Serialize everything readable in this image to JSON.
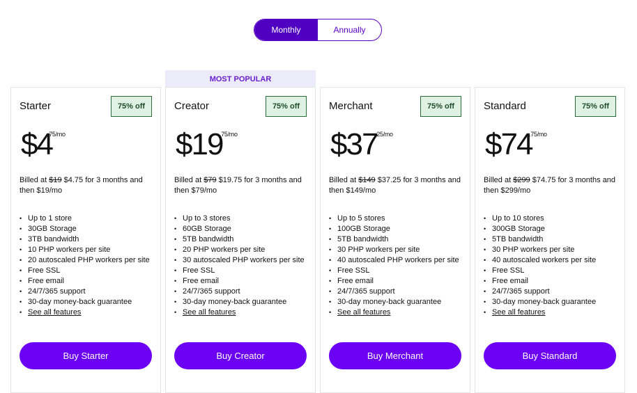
{
  "toggle": {
    "monthly": "Monthly",
    "annually": "Annually"
  },
  "popular_label": "MOST POPULAR",
  "plans": [
    {
      "name": "Starter",
      "badge": "75% off",
      "price": "$4",
      "cents": ".75/mo",
      "billed_prefix": "Billed at ",
      "old": "$19",
      "billed_rest": " $4.75 for 3 months and then $19/mo",
      "features": [
        "Up to 1 store",
        "30GB Storage",
        "3TB bandwidth",
        "10 PHP workers per site",
        "20 autoscaled PHP workers per site",
        "Free SSL",
        "Free email",
        "24/7/365 support",
        "30-day money-back guarantee"
      ],
      "link": "See all features",
      "button": "Buy Starter"
    },
    {
      "name": "Creator",
      "badge": "75% off",
      "price": "$19",
      "cents": ".75/mo",
      "billed_prefix": "Billed at ",
      "old": "$79",
      "billed_rest": " $19.75 for 3 months and then $79/mo",
      "features": [
        "Up to 3 stores",
        "60GB Storage",
        "5TB bandwidth",
        "20 PHP workers per site",
        "30 autoscaled PHP workers per site",
        "Free SSL",
        "Free email",
        "24/7/365 support",
        "30-day money-back guarantee"
      ],
      "link": "See all features",
      "button": "Buy Creator"
    },
    {
      "name": "Merchant",
      "badge": "75% off",
      "price": "$37",
      "cents": ".25/mo",
      "billed_prefix": "Billed at ",
      "old": "$149",
      "billed_rest": " $37.25 for 3 months and then $149/mo",
      "features": [
        "Up to 5 stores",
        "100GB Storage",
        "5TB bandwidth",
        "30 PHP workers per site",
        "40 autoscaled PHP workers per site",
        "Free SSL",
        "Free email",
        "24/7/365 support",
        "30-day money-back guarantee"
      ],
      "link": "See all features",
      "button": "Buy Merchant"
    },
    {
      "name": "Standard",
      "badge": "75% off",
      "price": "$74",
      "cents": ".75/mo",
      "billed_prefix": "Billed at ",
      "old": "$299",
      "billed_rest": " $74.75 for 3 months and then $299/mo",
      "features": [
        "Up to 10 stores",
        "300GB Storage",
        "5TB bandwidth",
        "30 PHP workers per site",
        "40 autoscaled workers per site",
        "Free SSL",
        "Free email",
        "24/7/365 support",
        "30-day money-back guarantee"
      ],
      "link": "See all features",
      "button": "Buy Standard"
    }
  ]
}
